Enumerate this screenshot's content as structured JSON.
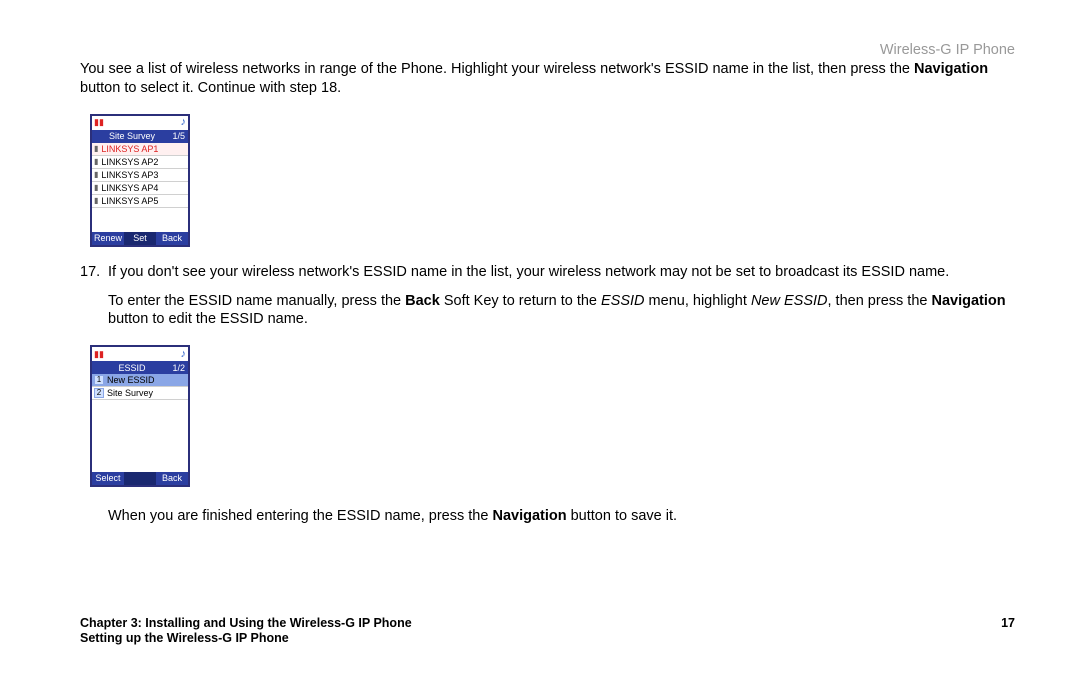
{
  "header": {
    "title": "Wireless-G IP Phone"
  },
  "intro": {
    "p1a": "You see a list of wireless networks in range of the Phone. Highlight your wireless network's ESSID name in the list, then press the ",
    "p1b": "Navigation",
    "p1c": " button to select it. Continue with step 18."
  },
  "phone1": {
    "title": "Site Survey",
    "pager": "1/5",
    "rows": [
      {
        "name": "LINKSYS AP1",
        "hl": true
      },
      {
        "name": "LINKSYS AP2"
      },
      {
        "name": "LINKSYS AP3"
      },
      {
        "name": "LINKSYS AP4"
      },
      {
        "name": "LINKSYS AP5"
      }
    ],
    "softkeys": {
      "left": "Renew",
      "mid": "Set",
      "right": "Back"
    }
  },
  "step17": {
    "num": "17.",
    "a": "If you don't see your wireless network's ESSID name in the list, your wireless network may not be set to broadcast its ESSID name.",
    "b1": "To enter the ESSID name manually, press the ",
    "b2": "Back",
    "b3": " Soft Key to return to the ",
    "b4": "ESSID",
    "b5": " menu, highlight ",
    "b6": "New ESSID",
    "b7": ", then press the ",
    "b8": "Navigation",
    "b9": " button to edit the ESSID name."
  },
  "phone2": {
    "title": "ESSID",
    "pager": "1/2",
    "rows": [
      {
        "num": "1",
        "name": "New ESSID",
        "hlblue": true
      },
      {
        "num": "2",
        "name": "Site Survey"
      }
    ],
    "softkeys": {
      "left": "Select",
      "mid": "",
      "right": "Back"
    }
  },
  "tail": {
    "a": "When you are finished entering the ESSID name, press the ",
    "b": "Navigation",
    "c": " button to save it."
  },
  "footer": {
    "chapter": "Chapter 3: Installing and Using the Wireless-G IP Phone",
    "page": "17",
    "sub": "Setting up the Wireless-G IP Phone"
  }
}
